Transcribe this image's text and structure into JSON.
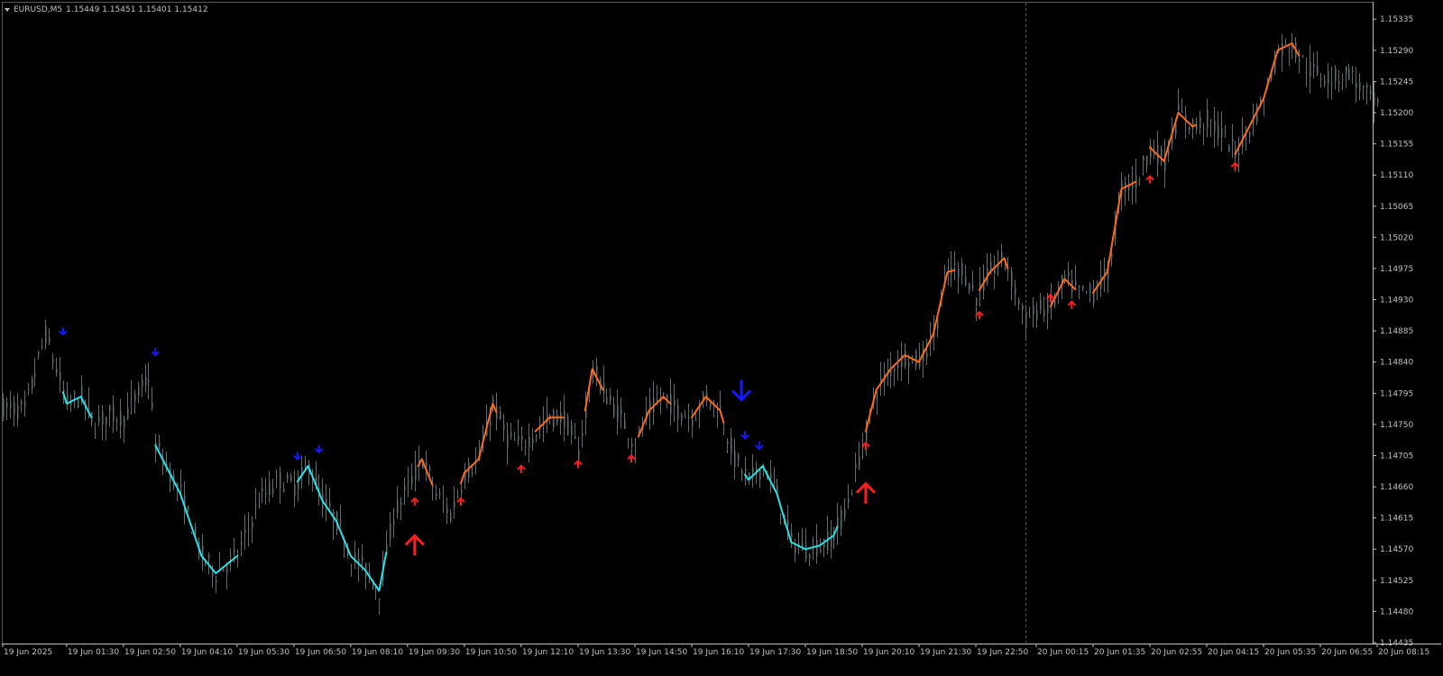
{
  "header": {
    "symbol": "EURUSD,M5",
    "ohlc": "1.15449 1.15451 1.15401 1.15412"
  },
  "colors": {
    "background": "#000000",
    "axis": "#c0c0c0",
    "candle": "#5e6f71",
    "downtrend_line": "#28e2e8",
    "uptrend_line": "#ff6a1a",
    "sell_arrow": "#1818ff",
    "buy_arrow": "#ff1e1e"
  },
  "icons": {
    "buy": "arrow-up-icon",
    "sell": "arrow-down-icon",
    "symbol_menu": "triangle-down-icon"
  },
  "chart_data": {
    "type": "candlestick",
    "symbol": "EURUSD",
    "timeframe": "M5",
    "ylim": [
      1.14435,
      1.1536
    ],
    "y_ticks": [
      "1.15335",
      "1.15290",
      "1.15245",
      "1.15200",
      "1.15155",
      "1.15110",
      "1.15065",
      "1.15020",
      "1.14975",
      "1.14930",
      "1.14885",
      "1.14840",
      "1.14795",
      "1.14750",
      "1.14705",
      "1.14660",
      "1.14615",
      "1.14570",
      "1.14525",
      "1.14480",
      "1.14435"
    ],
    "x_ticks": [
      "19 Jun 2025",
      "19 Jun 01:30",
      "19 Jun 02:50",
      "19 Jun 04:10",
      "19 Jun 05:30",
      "19 Jun 06:50",
      "19 Jun 08:10",
      "19 Jun 09:30",
      "19 Jun 10:50",
      "19 Jun 12:10",
      "19 Jun 13:30",
      "19 Jun 14:50",
      "19 Jun 16:10",
      "19 Jun 17:30",
      "19 Jun 18:50",
      "19 Jun 20:10",
      "19 Jun 21:30",
      "19 Jun 22:50",
      "20 Jun 00:15",
      "20 Jun 01:35",
      "20 Jun 02:55",
      "20 Jun 04:15",
      "20 Jun 05:35",
      "20 Jun 06:55",
      "20 Jun 08:15"
    ],
    "day_separator": "20 Jun 00:00",
    "price_path": [
      [
        "19 Jun 00:00",
        1.14775
      ],
      [
        "19 Jun 00:30",
        1.1477
      ],
      [
        "19 Jun 01:00",
        1.1488
      ],
      [
        "19 Jun 01:30",
        1.1478
      ],
      [
        "19 Jun 01:50",
        1.1479
      ],
      [
        "19 Jun 02:10",
        1.1475
      ],
      [
        "19 Jun 02:30",
        1.14765
      ],
      [
        "19 Jun 02:50",
        1.1476
      ],
      [
        "19 Jun 03:25",
        1.1482
      ],
      [
        "19 Jun 03:35",
        1.1472
      ],
      [
        "19 Jun 03:50",
        1.1469
      ],
      [
        "19 Jun 04:10",
        1.1465
      ],
      [
        "19 Jun 04:40",
        1.1456
      ],
      [
        "19 Jun 05:00",
        1.14535
      ],
      [
        "19 Jun 05:30",
        1.1456
      ],
      [
        "19 Jun 06:00",
        1.1464
      ],
      [
        "19 Jun 06:30",
        1.1467
      ],
      [
        "19 Jun 06:50",
        1.1466
      ],
      [
        "19 Jun 07:10",
        1.1469
      ],
      [
        "19 Jun 07:30",
        1.1464
      ],
      [
        "19 Jun 07:50",
        1.1461
      ],
      [
        "19 Jun 08:10",
        1.1456
      ],
      [
        "19 Jun 08:30",
        1.1454
      ],
      [
        "19 Jun 08:50",
        1.1451
      ],
      [
        "19 Jun 09:10",
        1.1462
      ],
      [
        "19 Jun 09:30",
        1.1466
      ],
      [
        "19 Jun 09:50",
        1.147
      ],
      [
        "19 Jun 10:10",
        1.1465
      ],
      [
        "19 Jun 10:30",
        1.1462
      ],
      [
        "19 Jun 10:50",
        1.1468
      ],
      [
        "19 Jun 11:10",
        1.147
      ],
      [
        "19 Jun 11:30",
        1.1478
      ],
      [
        "19 Jun 11:50",
        1.1473
      ],
      [
        "19 Jun 12:10",
        1.1472
      ],
      [
        "19 Jun 12:30",
        1.1474
      ],
      [
        "19 Jun 12:50",
        1.1476
      ],
      [
        "19 Jun 13:10",
        1.1476
      ],
      [
        "19 Jun 13:30",
        1.1471
      ],
      [
        "19 Jun 13:50",
        1.1483
      ],
      [
        "19 Jun 14:10",
        1.1479
      ],
      [
        "19 Jun 14:30",
        1.1476
      ],
      [
        "19 Jun 14:50",
        1.1472
      ],
      [
        "19 Jun 15:10",
        1.1477
      ],
      [
        "19 Jun 15:30",
        1.1479
      ],
      [
        "19 Jun 15:50",
        1.1477
      ],
      [
        "19 Jun 16:10",
        1.1476
      ],
      [
        "19 Jun 16:30",
        1.1479
      ],
      [
        "19 Jun 16:50",
        1.1477
      ],
      [
        "19 Jun 17:10",
        1.147
      ],
      [
        "19 Jun 17:30",
        1.1467
      ],
      [
        "19 Jun 17:50",
        1.1469
      ],
      [
        "19 Jun 18:10",
        1.1465
      ],
      [
        "19 Jun 18:30",
        1.1458
      ],
      [
        "19 Jun 18:50",
        1.1457
      ],
      [
        "19 Jun 19:10",
        1.14575
      ],
      [
        "19 Jun 19:30",
        1.1459
      ],
      [
        "19 Jun 19:50",
        1.1464
      ],
      [
        "19 Jun 20:10",
        1.1472
      ],
      [
        "19 Jun 20:30",
        1.148
      ],
      [
        "19 Jun 20:50",
        1.1483
      ],
      [
        "19 Jun 21:10",
        1.1485
      ],
      [
        "19 Jun 21:30",
        1.1484
      ],
      [
        "19 Jun 21:50",
        1.1488
      ],
      [
        "19 Jun 22:10",
        1.1497
      ],
      [
        "19 Jun 22:30",
        1.14975
      ],
      [
        "19 Jun 22:50",
        1.14935
      ],
      [
        "19 Jun 23:10",
        1.1497
      ],
      [
        "19 Jun 23:30",
        1.1499
      ],
      [
        "20 Jun 00:00",
        1.149
      ],
      [
        "20 Jun 00:15",
        1.14915
      ],
      [
        "20 Jun 00:35",
        1.1492
      ],
      [
        "20 Jun 00:55",
        1.1496
      ],
      [
        "20 Jun 01:15",
        1.1494
      ],
      [
        "20 Jun 01:35",
        1.1494
      ],
      [
        "20 Jun 01:55",
        1.1497
      ],
      [
        "20 Jun 02:15",
        1.1509
      ],
      [
        "20 Jun 02:35",
        1.151
      ],
      [
        "20 Jun 02:55",
        1.1515
      ],
      [
        "20 Jun 03:15",
        1.1513
      ],
      [
        "20 Jun 03:35",
        1.152
      ],
      [
        "20 Jun 03:55",
        1.1518
      ],
      [
        "20 Jun 04:15",
        1.1519
      ],
      [
        "20 Jun 04:35",
        1.1517
      ],
      [
        "20 Jun 04:55",
        1.1514
      ],
      [
        "20 Jun 05:15",
        1.1518
      ],
      [
        "20 Jun 05:35",
        1.1522
      ],
      [
        "20 Jun 05:55",
        1.1529
      ],
      [
        "20 Jun 06:15",
        1.153
      ],
      [
        "20 Jun 06:35",
        1.15265
      ],
      [
        "20 Jun 06:55",
        1.15255
      ],
      [
        "20 Jun 07:15",
        1.1525
      ],
      [
        "20 Jun 07:35",
        1.1526
      ],
      [
        "20 Jun 07:55",
        1.1523
      ],
      [
        "20 Jun 08:15",
        1.1521
      ]
    ],
    "trend_segments": [
      {
        "trend": "down",
        "from": "19 Jun 01:25",
        "to": "19 Jun 02:05"
      },
      {
        "trend": "down",
        "from": "19 Jun 03:35",
        "to": "19 Jun 05:30"
      },
      {
        "trend": "down",
        "from": "19 Jun 06:55",
        "to": "19 Jun 09:00"
      },
      {
        "trend": "up",
        "from": "19 Jun 09:45",
        "to": "19 Jun 10:05"
      },
      {
        "trend": "up",
        "from": "19 Jun 10:45",
        "to": "19 Jun 11:35"
      },
      {
        "trend": "up",
        "from": "19 Jun 12:30",
        "to": "19 Jun 13:10"
      },
      {
        "trend": "up",
        "from": "19 Jun 13:40",
        "to": "19 Jun 14:05"
      },
      {
        "trend": "up",
        "from": "19 Jun 14:55",
        "to": "19 Jun 15:40"
      },
      {
        "trend": "up",
        "from": "19 Jun 16:10",
        "to": "19 Jun 16:55"
      },
      {
        "trend": "down",
        "from": "19 Jun 17:25",
        "to": "19 Jun 19:35"
      },
      {
        "trend": "up",
        "from": "19 Jun 20:15",
        "to": "19 Jun 22:20"
      },
      {
        "trend": "up",
        "from": "19 Jun 22:55",
        "to": "19 Jun 23:35"
      },
      {
        "trend": "up",
        "from": "20 Jun 00:35",
        "to": "20 Jun 01:10"
      },
      {
        "trend": "up",
        "from": "20 Jun 01:35",
        "to": "20 Jun 02:35"
      },
      {
        "trend": "up",
        "from": "20 Jun 02:55",
        "to": "20 Jun 04:00"
      },
      {
        "trend": "up",
        "from": "20 Jun 04:55",
        "to": "20 Jun 06:25"
      }
    ],
    "signals": [
      {
        "type": "sell",
        "size": "small",
        "time": "19 Jun 01:25",
        "price": 1.14885
      },
      {
        "type": "sell",
        "size": "small",
        "time": "19 Jun 03:35",
        "price": 1.14855
      },
      {
        "type": "sell",
        "size": "small",
        "time": "19 Jun 06:55",
        "price": 1.14705
      },
      {
        "type": "sell",
        "size": "small",
        "time": "19 Jun 07:25",
        "price": 1.14715
      },
      {
        "type": "buy",
        "size": "large",
        "time": "19 Jun 09:40",
        "price": 1.14575
      },
      {
        "type": "buy",
        "size": "small",
        "time": "19 Jun 09:40",
        "price": 1.14638
      },
      {
        "type": "buy",
        "size": "small",
        "time": "19 Jun 10:45",
        "price": 1.14638
      },
      {
        "type": "buy",
        "size": "small",
        "time": "19 Jun 12:10",
        "price": 1.14685
      },
      {
        "type": "buy",
        "size": "small",
        "time": "19 Jun 13:30",
        "price": 1.14692
      },
      {
        "type": "buy",
        "size": "small",
        "time": "19 Jun 14:45",
        "price": 1.147
      },
      {
        "type": "sell",
        "size": "large",
        "time": "19 Jun 17:20",
        "price": 1.148
      },
      {
        "type": "sell",
        "size": "small",
        "time": "19 Jun 17:25",
        "price": 1.14735
      },
      {
        "type": "sell",
        "size": "small",
        "time": "19 Jun 17:45",
        "price": 1.1472
      },
      {
        "type": "buy",
        "size": "large",
        "time": "19 Jun 20:15",
        "price": 1.1465
      },
      {
        "type": "buy",
        "size": "small",
        "time": "19 Jun 20:15",
        "price": 1.14718
      },
      {
        "type": "buy",
        "size": "small",
        "time": "19 Jun 22:55",
        "price": 1.14907
      },
      {
        "type": "buy",
        "size": "small",
        "time": "20 Jun 00:35",
        "price": 1.14932
      },
      {
        "type": "buy",
        "size": "small",
        "time": "20 Jun 01:05",
        "price": 1.14922
      },
      {
        "type": "buy",
        "size": "small",
        "time": "20 Jun 02:55",
        "price": 1.15103
      },
      {
        "type": "buy",
        "size": "small",
        "time": "20 Jun 04:55",
        "price": 1.15122
      }
    ]
  }
}
